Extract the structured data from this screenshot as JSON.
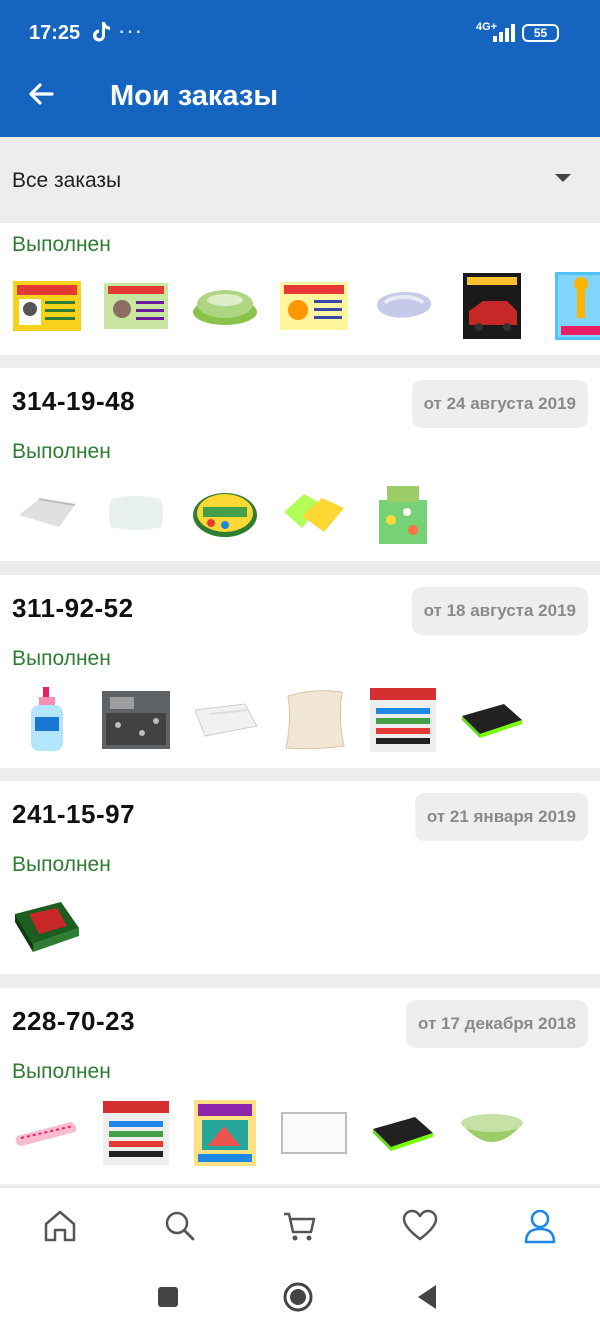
{
  "status_bar": {
    "time": "17:25",
    "dots": "···",
    "network": "4G+",
    "battery": "55"
  },
  "app_bar": {
    "title": "Мои заказы"
  },
  "filter": {
    "selected": "Все заказы"
  },
  "orders": [
    {
      "status": "Выполнен",
      "items": [
        "copybook-cat",
        "copybook-dog",
        "green-soap-dish",
        "copybook-tiger",
        "bath-sponge",
        "colored-pencils-box",
        "giraffe-copybook"
      ]
    },
    {
      "number": "314-19-48",
      "date": "от 24 августа 2019",
      "status": "Выполнен",
      "items": [
        "blanket",
        "pillow",
        "vaseline-tin",
        "cleaning-cloths",
        "bedding-set"
      ]
    },
    {
      "number": "311-92-52",
      "date": "от 18 августа 2019",
      "status": "Выполнен",
      "items": [
        "baby-soap-bottle",
        "bedding-grey",
        "blanket-white",
        "pillow-beige",
        "markers-set",
        "whiteboard-eraser"
      ]
    },
    {
      "number": "241-15-97",
      "date": "от 21 января 2019",
      "status": "Выполнен",
      "items": [
        "gift-box-green"
      ]
    },
    {
      "number": "228-70-23",
      "date": "от 17 декабря 2018",
      "status": "Выполнен",
      "items": [
        "pencil-case-pink",
        "markers-set",
        "colored-markers-pack",
        "whiteboard",
        "whiteboard-eraser",
        "green-bowl"
      ]
    }
  ],
  "bottom_nav": [
    {
      "icon": "home-icon",
      "active": false
    },
    {
      "icon": "search-icon",
      "active": false
    },
    {
      "icon": "cart-icon",
      "active": false
    },
    {
      "icon": "heart-icon",
      "active": false
    },
    {
      "icon": "profile-icon",
      "active": true
    }
  ],
  "system_nav": [
    "recents-icon",
    "home-circle-icon",
    "back-triangle-icon"
  ],
  "colors": {
    "primary": "#1565c0",
    "status_green": "#2e7d32",
    "active_nav": "#1e88e5",
    "inactive_nav": "#555555"
  }
}
